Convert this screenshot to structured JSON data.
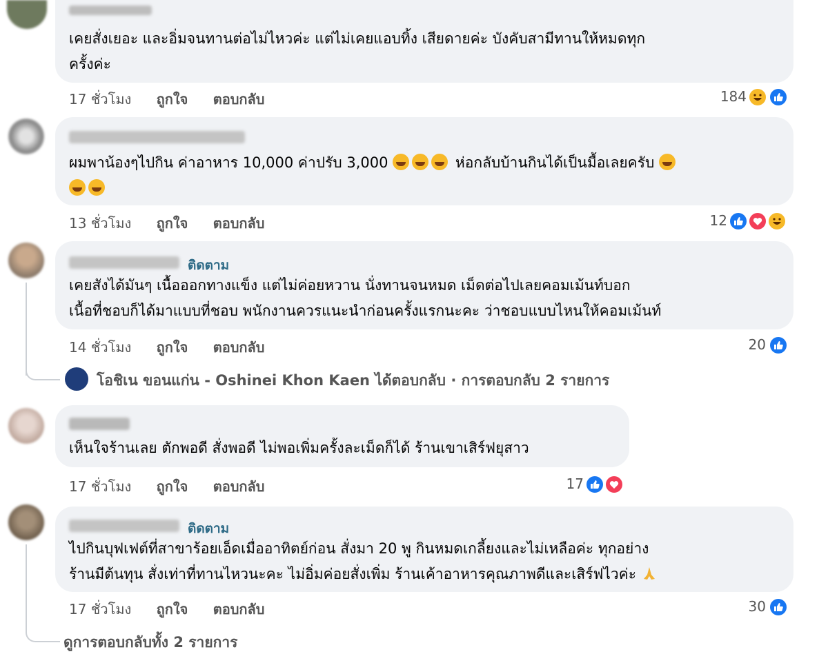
{
  "comments": [
    {
      "text_lines": [
        "เคยสั่งเยอะ และอิ่มจนทานต่อไม่ไหวค่ะ แต่ไม่เคยแอบทิ้ง เสียดายค่ะ บังคับสามีทานให้หมดทุก",
        "ครั้งค่ะ"
      ],
      "time": "17 ชั่วโมง",
      "like": "ถูกใจ",
      "reply": "ตอบกลับ",
      "reactions_count": "184"
    },
    {
      "text_line1": "ผมพาน้องๆไปกิน ค่าอาหาร 10,000 ค่าปรับ 3,000",
      "text_line1b": "ห่อกลับบ้านกินได้เป็นมื้อเลยครับ",
      "time": "13 ชั่วโมง",
      "like": "ถูกใจ",
      "reply": "ตอบกลับ",
      "reactions_count": "12"
    },
    {
      "follow": "ติดตาม",
      "text_lines": [
        "เคยสังได้มันๆ เนื้อออกทางแข็ง แต่ไม่ค่อยหวาน นั่งทานจนหมด เม็ดต่อไปเลยคอมเม้นท์บอก",
        "เนื้อที่ชอบก็ได้มาแบบที่ชอบ พนักงานควรแนะนำก่อนครั้งแรกนะคะ ว่าชอบแบบไหนให้คอมเม้นท์"
      ],
      "time": "14 ชั่วโมง",
      "like": "ถูกใจ",
      "reply": "ตอบกลับ",
      "reactions_count": "20",
      "page_reply": "โอชิเน ขอนแก่น - Oshinei Khon Kaen ได้ตอบกลับ · การตอบกลับ 2 รายการ"
    },
    {
      "text_lines": [
        "เห็นใจร้านเลย ตักพอดี สั่งพอดี ไม่พอเพิ่มครั้งละเม็ดก็ได้ ร้านเขาเสิร์ฟยุสาว"
      ],
      "time": "17 ชั่วโมง",
      "like": "ถูกใจ",
      "reply": "ตอบกลับ",
      "reactions_count": "17"
    },
    {
      "follow": "ติดตาม",
      "text_lines": [
        "ไปกินบุฟเฟต์ที่สาขาร้อยเอ็ดเมื่ออาทิตย์ก่อน สั่งมา 20 พู กินหมดเกลี้ยงและไม่เหลือค่ะ ทุกอย่าง",
        "ร้านมีต้นทุน สั่งเท่าที่ทานไหวนะคะ ไม่อิ่มค่อยสั่งเพิ่ม ร้านเค้าอาหารคุณภาพดีและเสิร์ฟไวค่ะ"
      ],
      "time": "17 ชั่วโมง",
      "like": "ถูกใจ",
      "reply": "ตอบกลับ",
      "reactions_count": "30",
      "view_replies": "ดูการตอบกลับทั้ง 2 รายการ"
    }
  ],
  "colors": {
    "like": "#1877f2",
    "love": "#f33e58",
    "haha": "#f7b928",
    "follow": "#2d6a86",
    "bubble": "#f0f2f5"
  }
}
